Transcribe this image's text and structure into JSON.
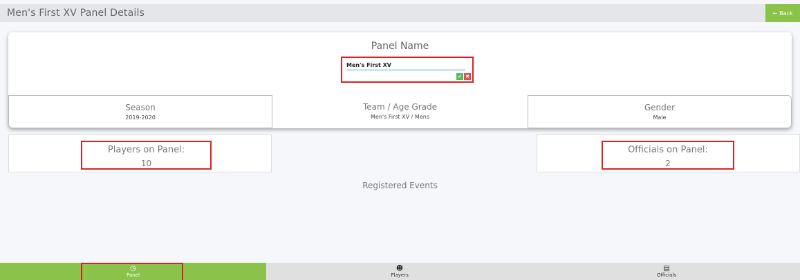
{
  "header": {
    "title": "Men's First XV Panel Details",
    "back_label": "Back"
  },
  "panel": {
    "name_label": "Panel Name",
    "name_value": "Men's First XV"
  },
  "info": {
    "season_label": "Season",
    "season_value": "2019-2020",
    "team_label": "Team / Age Grade",
    "team_value": "Men's First XV / Mens",
    "gender_label": "Gender",
    "gender_value": "Male"
  },
  "counts": {
    "players_label": "Players on Panel:",
    "players_value": "10",
    "officials_label": "Officials on Panel:",
    "officials_value": "2"
  },
  "registered_label": "Registered Events",
  "nav": {
    "tabs": [
      {
        "label": "Panel",
        "icon": "clock-icon"
      },
      {
        "label": "Players",
        "icon": "add-user-icon"
      },
      {
        "label": "Officials",
        "icon": "id-card-icon"
      }
    ]
  },
  "colors": {
    "accent": "#8bc34a",
    "highlight": "#e02020"
  }
}
